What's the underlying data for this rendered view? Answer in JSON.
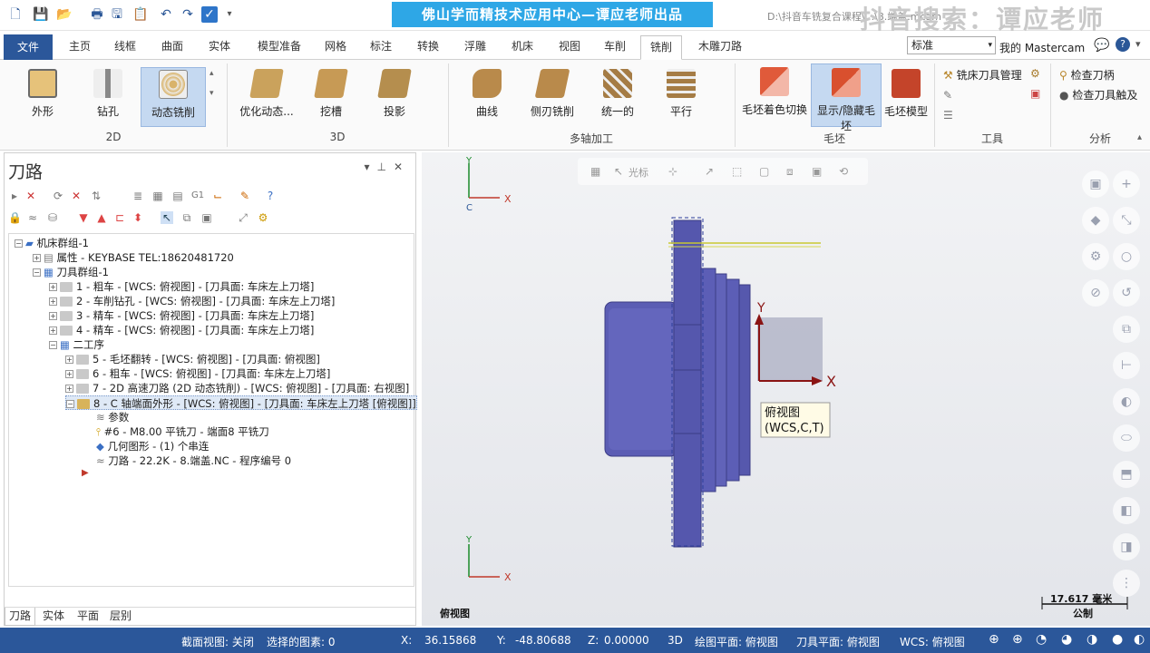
{
  "banner": "佛山学而精技术应用中心—谭应老师出品",
  "file_path": "D:\\抖音车铣复合课程\\...\\8.端盖.mcam",
  "watermark": "抖音搜索：谭应老师",
  "tabs": [
    "文件",
    "主页",
    "线框",
    "曲面",
    "实体",
    "模型准备",
    "网格",
    "标注",
    "转换",
    "浮雕",
    "机床",
    "视图",
    "车削",
    "铣削",
    "木雕刀路"
  ],
  "active_tab": "铣削",
  "ribbon_right": {
    "combo_value": "标准",
    "my_mastercam": "我的 Mastercam"
  },
  "ribbon": {
    "group_2d": {
      "label": "2D",
      "buttons": [
        "外形",
        "钻孔",
        "动态铣削"
      ]
    },
    "group_3d": {
      "label": "3D",
      "buttons": [
        "优化动态...",
        "挖槽",
        "投影"
      ]
    },
    "group_multi": {
      "label": "多轴加工",
      "buttons": [
        "曲线",
        "侧刃铣削",
        "统一的",
        "平行"
      ]
    },
    "group_stock": {
      "label": "毛坯",
      "buttons": [
        "毛坯着色切换",
        "显示/隐藏毛坯",
        "毛坯模型"
      ]
    },
    "group_tools": {
      "label": "工具",
      "buttons": [
        "铣床刀具管理"
      ]
    },
    "group_analysis": {
      "label": "分析",
      "buttons": [
        "检查刀柄",
        "检查刀具触及"
      ]
    }
  },
  "panel": {
    "title": "刀路",
    "tabs": [
      "刀路",
      "实体",
      "平面",
      "层别"
    ]
  },
  "tree": [
    {
      "text": "机床群组-1"
    },
    {
      "text": "属性 - KEYBASE TEL:18620481720"
    },
    {
      "text": "刀具群组-1"
    },
    {
      "text": "1 - 粗车 - [WCS: 俯视图] - [刀具面: 车床左上刀塔]"
    },
    {
      "text": "2 - 车削钻孔 - [WCS: 俯视图] - [刀具面: 车床左上刀塔]"
    },
    {
      "text": "3 - 精车 - [WCS: 俯视图] - [刀具面: 车床左上刀塔]"
    },
    {
      "text": "4 - 精车 - [WCS: 俯视图] - [刀具面: 车床左上刀塔]"
    },
    {
      "text": "二工序"
    },
    {
      "text": "5 - 毛坯翻转 - [WCS: 俯视图] - [刀具面: 俯视图]"
    },
    {
      "text": "6 - 粗车 - [WCS: 俯视图] - [刀具面: 车床左上刀塔]"
    },
    {
      "text": "7 - 2D 高速刀路 (2D 动态铣削) - [WCS: 俯视图] - [刀具面: 右视图]"
    },
    {
      "text": "8 - C 轴端面外形 - [WCS: 俯视图] - [刀具面: 车床左上刀塔 [俯视图]]"
    },
    {
      "text": "参数"
    },
    {
      "text": "#6 - M8.00 平铣刀 - 端面8 平铣刀"
    },
    {
      "text": "几何图形 - (1) 个串连"
    },
    {
      "text": "刀路 - 22.2K - 8.端盖.NC - 程序编号 0"
    }
  ],
  "viewport": {
    "vt_label": "光标",
    "plane_tooltip_line1": "俯视图",
    "plane_tooltip_line2": "(WCS,C,T)",
    "view_name": "俯视图",
    "scale_value": "17.617 毫米",
    "scale_unit": "公制",
    "axis_top": {
      "x": "X",
      "y": "Y",
      "c": "C"
    },
    "axis_bottom": {
      "x": "X",
      "y": "Y"
    },
    "axis_main": {
      "x": "X",
      "y": "Y"
    }
  },
  "status": {
    "section_view": "截面视图: 关闭",
    "selected": "选择的图素: 0",
    "x_label": "X:",
    "x": "36.15868",
    "y_label": "Y:",
    "y": "-48.80688",
    "z_label": "Z:",
    "z": "0.00000",
    "mode": "3D",
    "draw_plane": "绘图平面: 俯视图",
    "tool_plane": "刀具平面: 俯视图",
    "wcs": "WCS: 俯视图"
  },
  "colors": {
    "file_tab": "#2b579a",
    "status_bar": "#2b579a",
    "banner": "#2ea7e6",
    "part": "#5a5cb0"
  }
}
